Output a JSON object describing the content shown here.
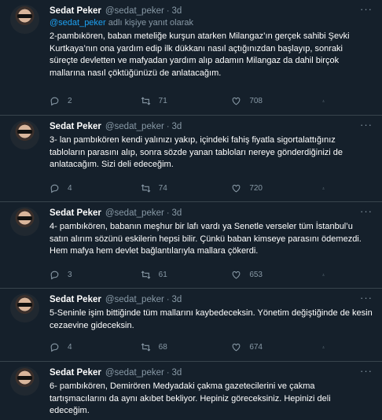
{
  "tweets": [
    {
      "name": "Sedat Peker",
      "handle": "@sedat_peker",
      "time": "3d",
      "reply_mention": "@sedat_peker",
      "reply_suffix": " adlı kişiye yanıt olarak",
      "text": "2-pambıkören, baban meteliğe kurşun atarken Milangaz’ın gerçek sahibi Şevki Kurtkaya’nın ona yardım edip ilk dükkanı nasıl açtığınızdan başlayıp, sonraki süreçte devletten ve mafyadan yardım alıp adamın Milangaz da dahil birçok mallarına nasıl çöktüğünüzü de anlatacağım.",
      "replies": "2",
      "retweets": "71",
      "likes": "708"
    },
    {
      "name": "Sedat Peker",
      "handle": "@sedat_peker",
      "time": "3d",
      "text": "3- lan pambıkören kendi yalınızı yakıp, içindeki fahiş fiyatla sigortalattığınız tabloların parasını alıp, sonra sözde yanan tabloları nereye gönderdiğinizi de anlatacağım. Sizi deli edeceğim.",
      "replies": "4",
      "retweets": "74",
      "likes": "720"
    },
    {
      "name": "Sedat Peker",
      "handle": "@sedat_peker",
      "time": "3d",
      "text": "4- pambıkören, babanın meşhur bir lafı vardı ya Senetle verseler tüm İstanbul’u satın alırım sözünü eskilerin hepsi bilir. Çünkü baban kimseye parasını ödemezdi. Hem mafya hem devlet bağlantılarıyla mallara çökerdi.",
      "replies": "3",
      "retweets": "61",
      "likes": "653"
    },
    {
      "name": "Sedat Peker",
      "handle": "@sedat_peker",
      "time": "3d",
      "text": "5-Seninle işim bittiğinde tüm mallarını kaybedeceksin. Yönetim değiştiğinde de kesin cezaevine gideceksin.",
      "replies": "4",
      "retweets": "68",
      "likes": "674"
    },
    {
      "name": "Sedat Peker",
      "handle": "@sedat_peker",
      "time": "3d",
      "text": "6- pambıkören, Demirören Medyadaki çakma gazetecilerini ve çakma tartışmacılarını da aynı akıbet bekliyor. Hepiniz göreceksiniz. Hepinizi deli edeceğim."
    }
  ],
  "icons": {
    "more": "more-icon",
    "reply": "reply-icon",
    "retweet": "retweet-icon",
    "like": "heart-icon",
    "share": "share-icon"
  }
}
